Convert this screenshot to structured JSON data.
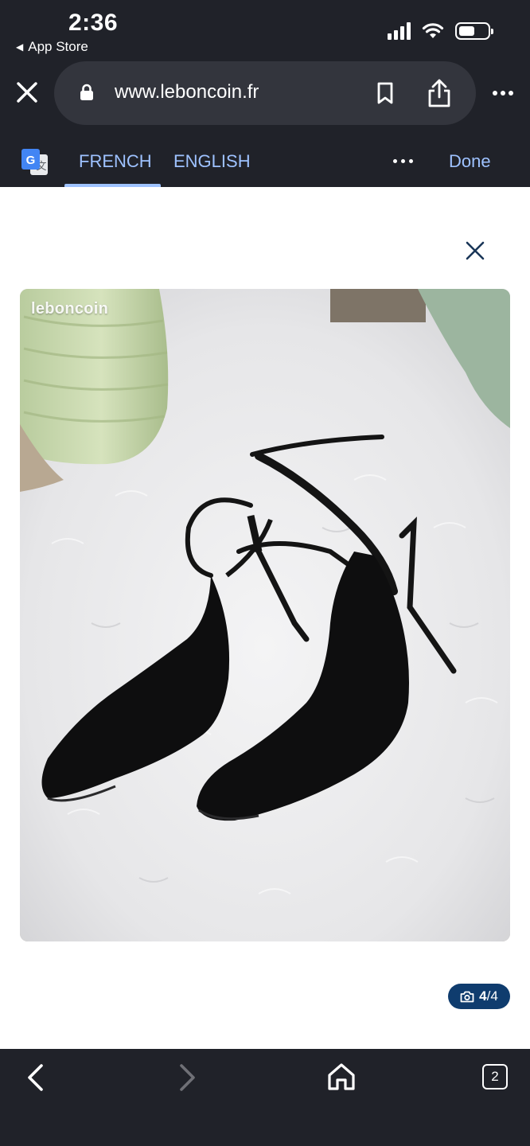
{
  "status_bar": {
    "time": "2:36",
    "back_app": "App Store"
  },
  "browser": {
    "url": "www.leboncoin.fr"
  },
  "translate_bar": {
    "icon": "google-translate-icon",
    "languages": [
      {
        "label": "FRENCH",
        "selected": true
      },
      {
        "label": "ENGLISH",
        "selected": false
      }
    ],
    "done_label": "Done"
  },
  "gallery": {
    "watermark": "leboncoin",
    "counter_current": "4",
    "counter_total": "/4",
    "image_subject": "black slingback heels on white fur rug"
  },
  "bottom_toolbar": {
    "tab_count": "2"
  },
  "colors": {
    "chrome_bg": "#202229",
    "url_pill_bg": "#33353d",
    "accent_link": "#9ec2ff",
    "counter_badge": "#0f3c6e"
  }
}
